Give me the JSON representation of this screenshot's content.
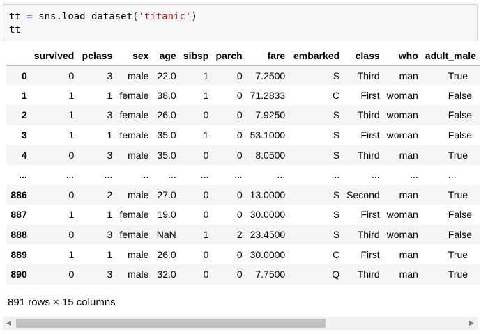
{
  "code_cell": {
    "line1": {
      "var": "tt",
      "op": "=",
      "call": "sns.load_dataset(",
      "arg": "'titanic'",
      "close": ")"
    },
    "line2": "tt"
  },
  "dataframe": {
    "columns": [
      "",
      "survived",
      "pclass",
      "sex",
      "age",
      "sibsp",
      "parch",
      "fare",
      "embarked",
      "class",
      "who",
      "adult_male"
    ],
    "rows": [
      [
        "0",
        "0",
        "3",
        "male",
        "22.0",
        "1",
        "0",
        "7.2500",
        "S",
        "Third",
        "man",
        "True"
      ],
      [
        "1",
        "1",
        "1",
        "female",
        "38.0",
        "1",
        "0",
        "71.2833",
        "C",
        "First",
        "woman",
        "False"
      ],
      [
        "2",
        "1",
        "3",
        "female",
        "26.0",
        "0",
        "0",
        "7.9250",
        "S",
        "Third",
        "woman",
        "False"
      ],
      [
        "3",
        "1",
        "1",
        "female",
        "35.0",
        "1",
        "0",
        "53.1000",
        "S",
        "First",
        "woman",
        "False"
      ],
      [
        "4",
        "0",
        "3",
        "male",
        "35.0",
        "0",
        "0",
        "8.0500",
        "S",
        "Third",
        "man",
        "True"
      ],
      [
        "...",
        "...",
        "...",
        "...",
        "...",
        "...",
        "...",
        "...",
        "...",
        "...",
        "...",
        "..."
      ],
      [
        "886",
        "0",
        "2",
        "male",
        "27.0",
        "0",
        "0",
        "13.0000",
        "S",
        "Second",
        "man",
        "True"
      ],
      [
        "887",
        "1",
        "1",
        "female",
        "19.0",
        "0",
        "0",
        "30.0000",
        "S",
        "First",
        "woman",
        "False"
      ],
      [
        "888",
        "0",
        "3",
        "female",
        "NaN",
        "1",
        "2",
        "23.4500",
        "S",
        "Third",
        "woman",
        "False"
      ],
      [
        "889",
        "1",
        "1",
        "male",
        "26.0",
        "0",
        "0",
        "30.0000",
        "C",
        "First",
        "man",
        "True"
      ],
      [
        "890",
        "0",
        "3",
        "male",
        "32.0",
        "0",
        "0",
        "7.7500",
        "Q",
        "Third",
        "man",
        "True"
      ]
    ]
  },
  "summary": "891 rows × 15 columns",
  "scrollbar": {
    "left_arrow": "◀",
    "right_arrow": "▶",
    "thumb_fraction": 0.69,
    "position_fraction": 0.0
  }
}
